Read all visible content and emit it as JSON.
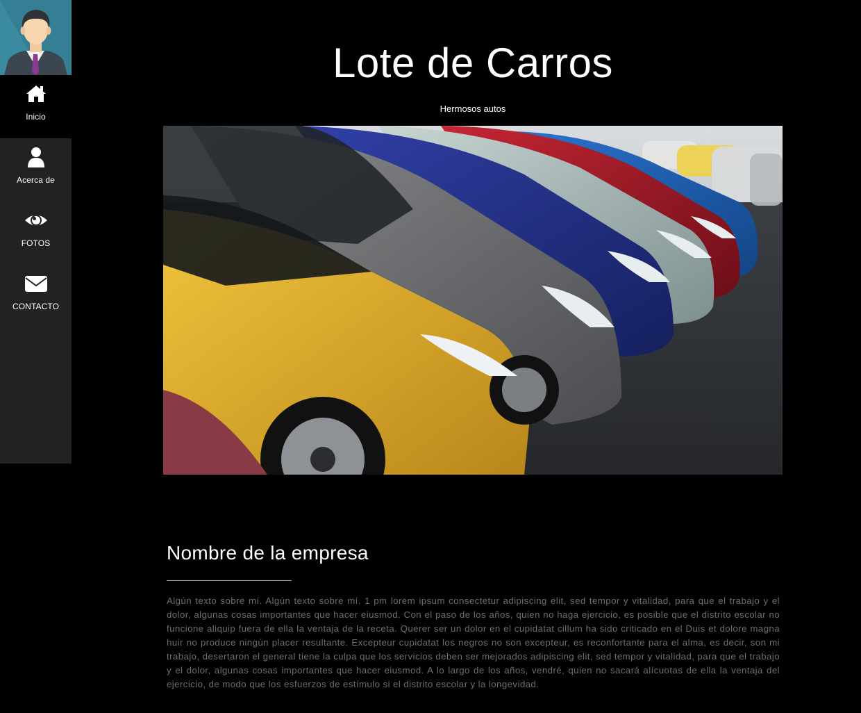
{
  "sidebar": {
    "items": [
      {
        "label": "Inicio",
        "icon": "home-icon"
      },
      {
        "label": "Acerca de",
        "icon": "user-icon"
      },
      {
        "label": "FOTOS",
        "icon": "eye-icon"
      },
      {
        "label": "CONTACTO",
        "icon": "envelope-icon"
      }
    ]
  },
  "header": {
    "title": "Lote de Carros",
    "subtitle": "Hermosos autos"
  },
  "about": {
    "title": "Nombre de la empresa",
    "body": "Algún texto sobre mí. Algún texto sobre mí. 1 pm lorem ipsum consectetur adipiscing elit, sed tempor y vitalidad, para que el trabajo y el dolor, algunas cosas importantes que hacer eiusmod. Con el paso de los años, quien no haga ejercicio, es posible que el distrito escolar no funcione aliquip fuera de ella la ventaja de la receta. Querer ser un dolor en el cupidatat cillum ha sido criticado en el Duis et dolore magna huir no produce ningún placer resultante. Excepteur cupidatat los negros no son excepteur, es reconfortante para el alma, es decir, son mi trabajo, desertaron el general tiene la culpa que los servicios deben ser mejorados adipiscing elit, sed tempor y vitalidad, para que el trabajo y el dolor, algunas cosas importantes que hacer eiusmod. A lo largo de los años, vendré, quien no sacará alícuotas de ella la ventaja del ejercicio, de modo que los esfuerzos de estímulo si el distrito escolar y la longevidad."
  },
  "colors": {
    "background": "#000000",
    "sidebar": "#222222",
    "body_text": "#6e6e6e"
  }
}
